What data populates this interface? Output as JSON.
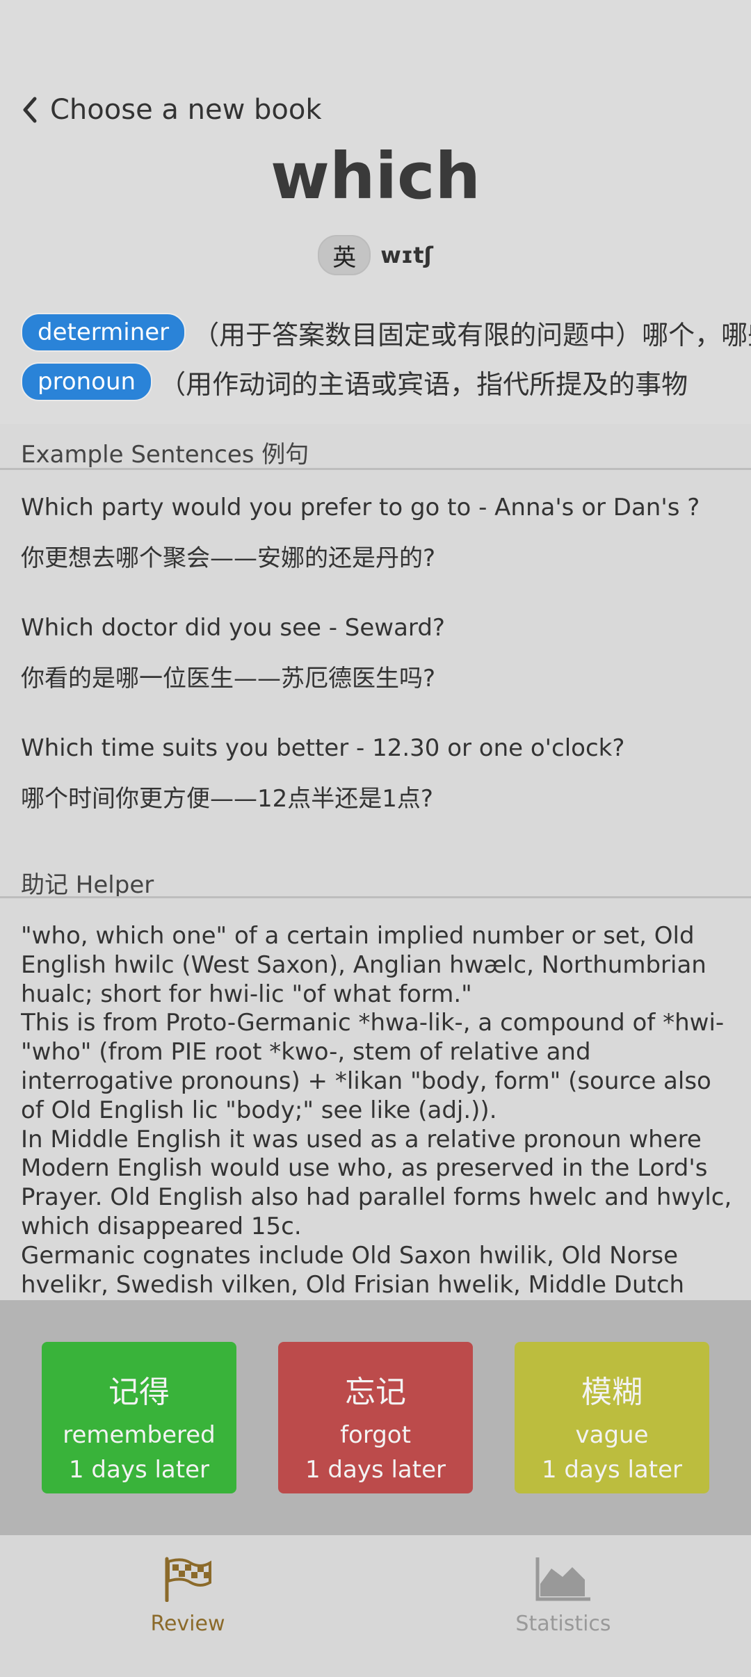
{
  "header": {
    "back_label": "Choose a new book",
    "word": "which",
    "pron_badge": "英",
    "phonetic": "wɪtʃ"
  },
  "definitions": [
    {
      "pos": "determiner",
      "text": "（用于答案数目固定或有限的问题中）哪个，哪些"
    },
    {
      "pos": "pronoun",
      "text": "（用作动词的主语或宾语，指代所提及的事物"
    }
  ],
  "examples": {
    "title": "Example Sentences 例句",
    "items": [
      {
        "en": "Which party would you prefer to go to - Anna's or Dan's ?",
        "zh": "你更想去哪个聚会——安娜的还是丹的?"
      },
      {
        "en": "Which doctor did you see - Seward?",
        "zh": "你看的是哪一位医生——苏厄德医生吗?"
      },
      {
        "en": "Which time suits you better - 12.30 or one o'clock?",
        "zh": "哪个时间你更方便——12点半还是1点?"
      }
    ]
  },
  "helper": {
    "title": "助记 Helper",
    "paragraphs": [
      "\"who, which one\" of a certain implied number or set, Old English hwilc (West Saxon), Anglian hwælc, Northumbrian hualc; short for hwi-lic \"of what form.\"",
      "This is from Proto-Germanic *hwa-lik-, a compound of *hwi- \"who\" (from PIE root *kwo-, stem of relative and interrogative pronouns) + *likan \"body, form\" (source also of Old English lic \"body;\" see like (adj.)).",
      "In Middle English it was used as a relative pronoun where Modern English would use who, as preserved in the Lord's Prayer. Old English also had parallel forms hwelc and hwylc, which disappeared 15c.",
      "Germanic cognates include Old Saxon hwilik, Old Norse hvelikr, Swedish vilken, Old Frisian hwelik, Middle Dutch wilk, Dutch"
    ]
  },
  "actions": [
    {
      "zh": "记得",
      "en": "remembered",
      "days": "1 days later",
      "color": "#39b33a"
    },
    {
      "zh": "忘记",
      "en": "forgot",
      "days": "1 days later",
      "color": "#bc4b4b"
    },
    {
      "zh": "模糊",
      "en": "vague",
      "days": "1 days later",
      "color": "#bcbd3e"
    }
  ],
  "nav": {
    "review_label": "Review",
    "stats_label": "Statistics",
    "active_color": "#8b6a2a",
    "inactive_color": "#999999"
  }
}
